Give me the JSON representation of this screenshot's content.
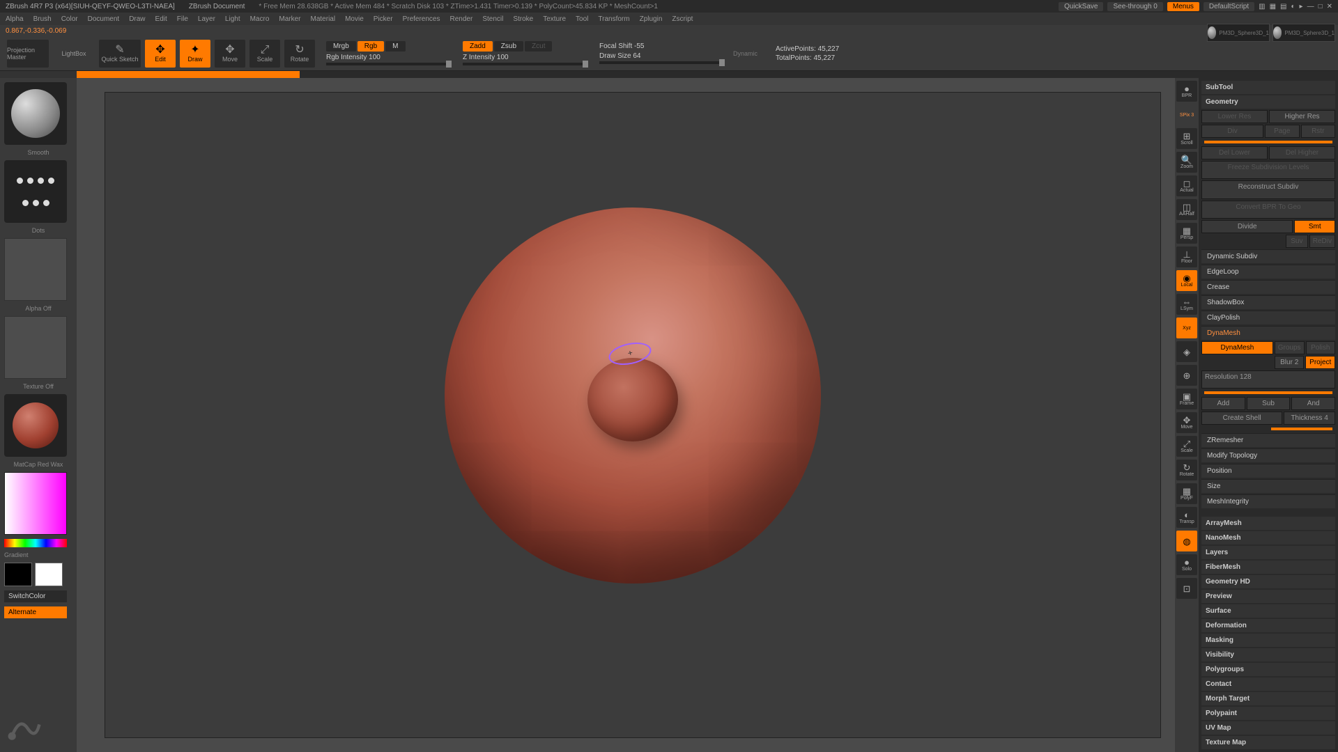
{
  "titlebar": {
    "app": "ZBrush 4R7 P3 (x64)[SIUH-QEYF-QWEO-L3TI-NAEA]",
    "doc": "ZBrush Document",
    "stats": "* Free Mem 28.638GB  *  Active Mem 484  *  Scratch Disk 103  *  ZTime>1.431  Timer>0.139  *  PolyCount>45.834 KP  *  MeshCount>1",
    "quicksave": "QuickSave",
    "seethrough": "See-through  0",
    "menus": "Menus",
    "script": "DefaultScript"
  },
  "menubar": [
    "Alpha",
    "Brush",
    "Color",
    "Document",
    "Draw",
    "Edit",
    "File",
    "Layer",
    "Light",
    "Macro",
    "Marker",
    "Material",
    "Movie",
    "Picker",
    "Preferences",
    "Render",
    "Stencil",
    "Stroke",
    "Texture",
    "Tool",
    "Transform",
    "Zplugin",
    "Zscript"
  ],
  "coord": "0.867,-0.336,-0.069",
  "toolbar": {
    "projection": "Projection Master",
    "lightbox": "LightBox",
    "quicksketch": "Quick Sketch",
    "edit": "Edit",
    "draw": "Draw",
    "move": "Move",
    "scale": "Scale",
    "rotate": "Rotate",
    "mrgb": "Mrgb",
    "rgb": "Rgb",
    "m": "M",
    "rgb_intensity": "Rgb Intensity 100",
    "zadd": "Zadd",
    "zsub": "Zsub",
    "zcut": "Zcut",
    "z_intensity": "Z Intensity 100",
    "focal_shift": "Focal Shift -55",
    "draw_size": "Draw Size 64",
    "dynamic": "Dynamic",
    "active_points": "ActivePoints: 45,227",
    "total_points": "TotalPoints: 45,227"
  },
  "left": {
    "brush": "Smooth",
    "stroke": "Dots",
    "alpha": "Alpha Off",
    "texture": "Texture Off",
    "material": "MatCap Red Wax",
    "gradient": "Gradient",
    "switchcolor": "SwitchColor",
    "alternate": "Alternate"
  },
  "iconstrip": [
    {
      "label": "BPR",
      "name": "bpr"
    },
    {
      "label": "SPix 3",
      "name": "spix"
    },
    {
      "label": "Scroll",
      "name": "scroll"
    },
    {
      "label": "Zoom",
      "name": "zoom"
    },
    {
      "label": "Actual",
      "name": "actual"
    },
    {
      "label": "AAHalf",
      "name": "aahalf"
    },
    {
      "label": "Persp",
      "name": "persp"
    },
    {
      "label": "Floor",
      "name": "floor"
    },
    {
      "label": "Local",
      "name": "local",
      "active": true
    },
    {
      "label": "LSym",
      "name": "lsym"
    },
    {
      "label": "Xyz",
      "name": "xyz",
      "active": true
    },
    {
      "label": "",
      "name": "cam1"
    },
    {
      "label": "",
      "name": "cam2"
    },
    {
      "label": "Frame",
      "name": "frame"
    },
    {
      "label": "Move",
      "name": "move3d"
    },
    {
      "label": "Scale",
      "name": "scale3d"
    },
    {
      "label": "Rotate",
      "name": "rotate3d"
    },
    {
      "label": "PolyF",
      "name": "polyf"
    },
    {
      "label": "Transp",
      "name": "transp"
    },
    {
      "label": "",
      "name": "ghost",
      "active": true
    },
    {
      "label": "Solo",
      "name": "solo"
    },
    {
      "label": "",
      "name": "xpose"
    }
  ],
  "right": {
    "thumbs": [
      "PM3D_Sphere3D_1",
      "PM3D_Sphere3D_1"
    ],
    "subtool": "SubTool",
    "geometry": "Geometry",
    "lower_res": "Lower Res",
    "higher_res": "Higher Res",
    "div": "Div",
    "page": "Page",
    "del_lower": "Del Lower",
    "del_higher": "Del Higher",
    "freeze": "Freeze Subdivision Levels",
    "reconstruct": "Reconstruct Subdiv",
    "convert": "Convert BPR To Geo",
    "divide": "Divide",
    "smt": "Smt",
    "suv": "Suv",
    "rediv": "ReDiv",
    "dynamic_subdiv": "Dynamic Subdiv",
    "edgeloop": "EdgeLoop",
    "crease": "Crease",
    "shadowbox": "ShadowBox",
    "claypolish": "ClayPolish",
    "dynamesh_head": "DynaMesh",
    "dynamesh": "DynaMesh",
    "groups": "Groups",
    "polish": "Polish",
    "blur": "Blur 2",
    "project": "Project",
    "resolution": "Resolution 128",
    "add": "Add",
    "sub": "Sub",
    "and": "And",
    "create_shell": "Create Shell",
    "thickness": "Thickness 4",
    "zremesher": "ZRemesher",
    "modify_topology": "Modify Topology",
    "position": "Position",
    "size": "Size",
    "meshintegrity": "MeshIntegrity",
    "sections": [
      "ArrayMesh",
      "NanoMesh",
      "Layers",
      "FiberMesh",
      "Geometry HD",
      "Preview",
      "Surface",
      "Deformation",
      "Masking",
      "Visibility",
      "Polygroups",
      "Contact",
      "Morph Target",
      "Polypaint",
      "UV Map",
      "Texture Map"
    ]
  }
}
